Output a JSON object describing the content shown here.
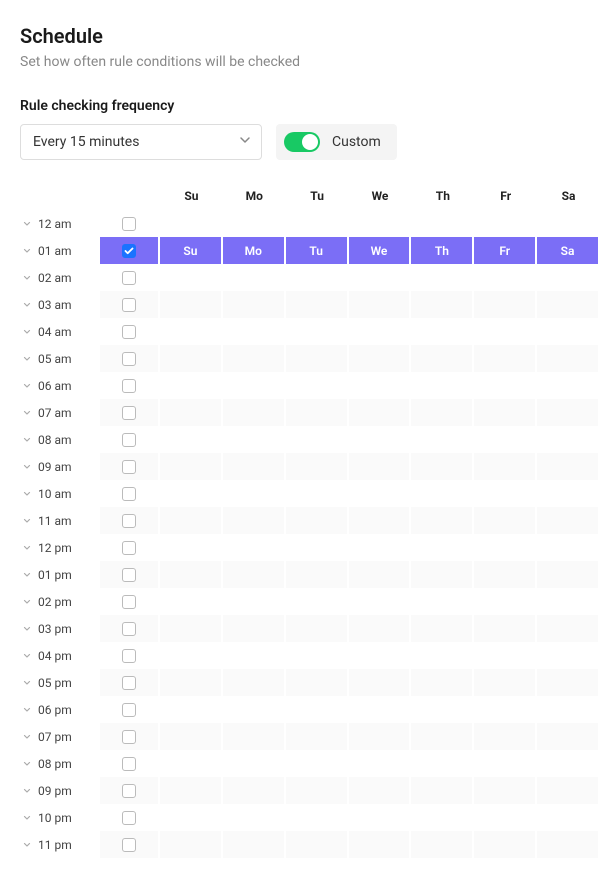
{
  "title": "Schedule",
  "subtitle": "Set how often rule conditions will be checked",
  "frequency": {
    "label": "Rule checking frequency",
    "selected": "Every 15 minutes",
    "custom_label": "Custom",
    "custom_on": true
  },
  "days": [
    "Su",
    "Mo",
    "Tu",
    "We",
    "Th",
    "Fr",
    "Sa"
  ],
  "hours": [
    {
      "label": "12 am",
      "checked": false,
      "selected": false
    },
    {
      "label": "01 am",
      "checked": true,
      "selected": true
    },
    {
      "label": "02 am",
      "checked": false,
      "selected": false
    },
    {
      "label": "03 am",
      "checked": false,
      "selected": false
    },
    {
      "label": "04 am",
      "checked": false,
      "selected": false
    },
    {
      "label": "05 am",
      "checked": false,
      "selected": false
    },
    {
      "label": "06 am",
      "checked": false,
      "selected": false
    },
    {
      "label": "07 am",
      "checked": false,
      "selected": false
    },
    {
      "label": "08 am",
      "checked": false,
      "selected": false
    },
    {
      "label": "09 am",
      "checked": false,
      "selected": false
    },
    {
      "label": "10 am",
      "checked": false,
      "selected": false
    },
    {
      "label": "11 am",
      "checked": false,
      "selected": false
    },
    {
      "label": "12 pm",
      "checked": false,
      "selected": false
    },
    {
      "label": "01 pm",
      "checked": false,
      "selected": false
    },
    {
      "label": "02 pm",
      "checked": false,
      "selected": false
    },
    {
      "label": "03 pm",
      "checked": false,
      "selected": false
    },
    {
      "label": "04 pm",
      "checked": false,
      "selected": false
    },
    {
      "label": "05 pm",
      "checked": false,
      "selected": false
    },
    {
      "label": "06 pm",
      "checked": false,
      "selected": false
    },
    {
      "label": "07 pm",
      "checked": false,
      "selected": false
    },
    {
      "label": "08 pm",
      "checked": false,
      "selected": false
    },
    {
      "label": "09 pm",
      "checked": false,
      "selected": false
    },
    {
      "label": "10 pm",
      "checked": false,
      "selected": false
    },
    {
      "label": "11 pm",
      "checked": false,
      "selected": false
    }
  ]
}
